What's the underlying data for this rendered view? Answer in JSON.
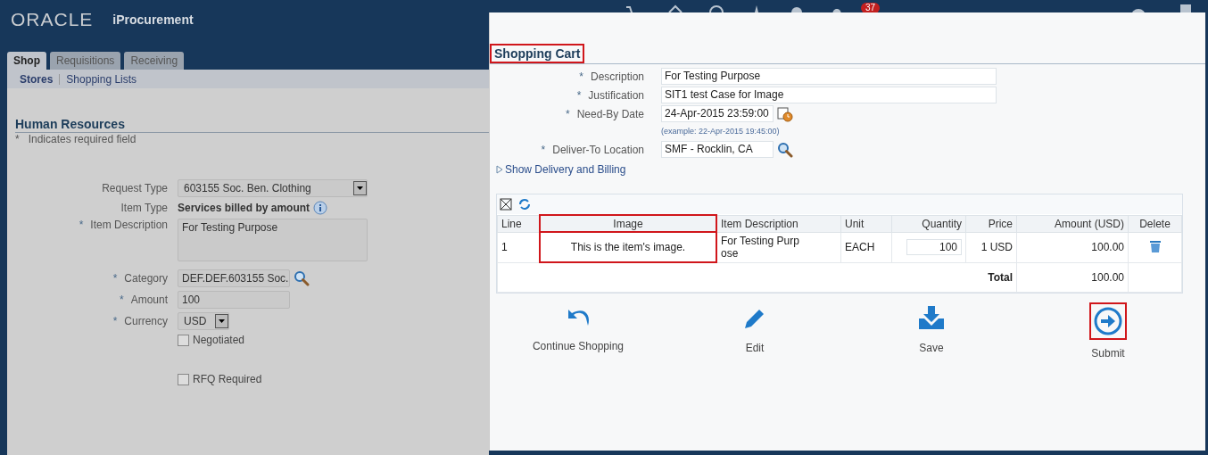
{
  "header": {
    "brand": "ORACLE",
    "app_title": "iProcurement",
    "notification_count": "37"
  },
  "tabs": [
    {
      "label": "Shop",
      "selected": true
    },
    {
      "label": "Requisitions",
      "selected": false
    },
    {
      "label": "Receiving",
      "selected": false
    }
  ],
  "subtabs": [
    {
      "label": "Stores",
      "selected": true
    },
    {
      "label": "Shopping Lists",
      "selected": false
    }
  ],
  "request_form": {
    "title": "Human Resources",
    "required_note_mark": "*",
    "required_note": "Indicates required field",
    "fields": [
      {
        "kind": "select",
        "label": "Request Type",
        "value": "603155 Soc. Ben. Clothing"
      },
      {
        "kind": "info",
        "label": "Item Type",
        "value": "Services billed by amount"
      },
      {
        "kind": "textarea",
        "label": "Item Description",
        "required": true,
        "value": "For Testing Purpose"
      },
      {
        "kind": "lookup",
        "label": "Category",
        "required": true,
        "value": "DEF.DEF.603155 Soc."
      },
      {
        "kind": "text",
        "label": "Amount",
        "required": true,
        "value": "100"
      },
      {
        "kind": "smallselect",
        "label": "Currency",
        "required": true,
        "value": "USD"
      },
      {
        "kind": "checkbox",
        "label": "Negotiated",
        "checked": false
      },
      {
        "kind": "checkbox",
        "label": "RFQ Required",
        "checked": false
      }
    ]
  },
  "cart": {
    "title": "Shopping Cart",
    "title_highlighted": true,
    "fields": [
      {
        "kind": "text",
        "label": "Description",
        "required": true,
        "value": "For Testing Purpose"
      },
      {
        "kind": "text",
        "label": "Justification",
        "required": true,
        "value": "SIT1 test Case for Image"
      },
      {
        "kind": "date",
        "label": "Need-By Date",
        "required": true,
        "value": "24-Apr-2015 23:59:00",
        "hint": "(example: 22-Apr-2015 19:45:00)"
      },
      {
        "kind": "lookup",
        "label": "Deliver-To Location",
        "required": true,
        "value": "SMF - Rocklin, CA"
      }
    ],
    "disclosure": {
      "label": "Show Delivery and Billing",
      "expanded": false
    },
    "table": {
      "columns": [
        {
          "label": "Line",
          "highlighted": false
        },
        {
          "label": "Image",
          "highlighted": true
        },
        {
          "label": "Item Description",
          "highlighted": false
        },
        {
          "label": "Unit",
          "highlighted": false
        },
        {
          "label": "Quantity",
          "highlighted": false
        },
        {
          "label": "Price",
          "highlighted": false
        },
        {
          "label": "Amount (USD)",
          "highlighted": false
        },
        {
          "label": "Delete",
          "highlighted": false
        }
      ],
      "rows": [
        {
          "line": "1",
          "image": "This is the item's image.",
          "item_description": "For Testing Purpose",
          "unit": "EACH",
          "quantity": "100",
          "price": "1 USD",
          "amount": "100.00"
        }
      ],
      "total_label": "Total",
      "total": "100.00"
    },
    "actions": [
      {
        "kind": "undo",
        "label": "Continue Shopping",
        "highlighted": false
      },
      {
        "kind": "edit",
        "label": "Edit",
        "highlighted": false
      },
      {
        "kind": "save",
        "label": "Save",
        "highlighted": false
      },
      {
        "kind": "submit",
        "label": "Submit",
        "highlighted": true
      }
    ]
  }
}
